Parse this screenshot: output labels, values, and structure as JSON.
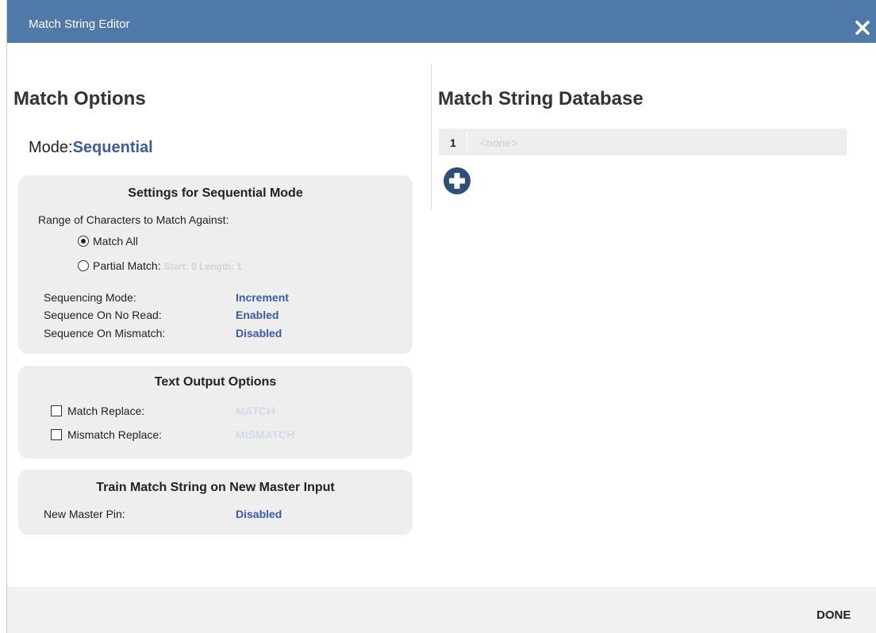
{
  "window": {
    "title": "Match String Editor"
  },
  "left": {
    "heading": "Match Options",
    "mode_label": "Mode:",
    "mode_value": "Sequential"
  },
  "sequential_panel": {
    "title": "Settings for Sequential Mode",
    "range_label": "Range of Characters to Match Against:",
    "match_all_label": "Match All",
    "match_all_selected": true,
    "partial_label": "Partial Match:",
    "partial_selected": false,
    "partial_details": "Start: 0  Length: 1",
    "settings": [
      {
        "label": "Sequencing Mode:",
        "value": "Increment"
      },
      {
        "label": "Sequence On No Read:",
        "value": "Enabled"
      },
      {
        "label": "Sequence On Mismatch:",
        "value": "Disabled"
      }
    ]
  },
  "text_output_panel": {
    "title": "Text Output Options",
    "match_replace_label": "Match Replace:",
    "match_replace_value": "MATCH",
    "match_replace_checked": false,
    "mismatch_replace_label": "Mismatch Replace:",
    "mismatch_replace_value": "MISMATCH",
    "mismatch_replace_checked": false
  },
  "train_panel": {
    "title": "Train Match String on New Master Input",
    "pin_label": "New Master Pin:",
    "pin_value": "Disabled"
  },
  "right": {
    "heading": "Match String Database",
    "rows": [
      {
        "index": "1",
        "value": "<none>"
      }
    ]
  },
  "footer": {
    "done_label": "DONE"
  },
  "colors": {
    "titlebar": "#4f79a8",
    "accent_value": "#3a5aa8",
    "panel_bg": "#eeeeee",
    "add_icon": "#2e4f7a"
  },
  "icons": {
    "close": "close-icon",
    "add": "plus-circle-icon"
  }
}
